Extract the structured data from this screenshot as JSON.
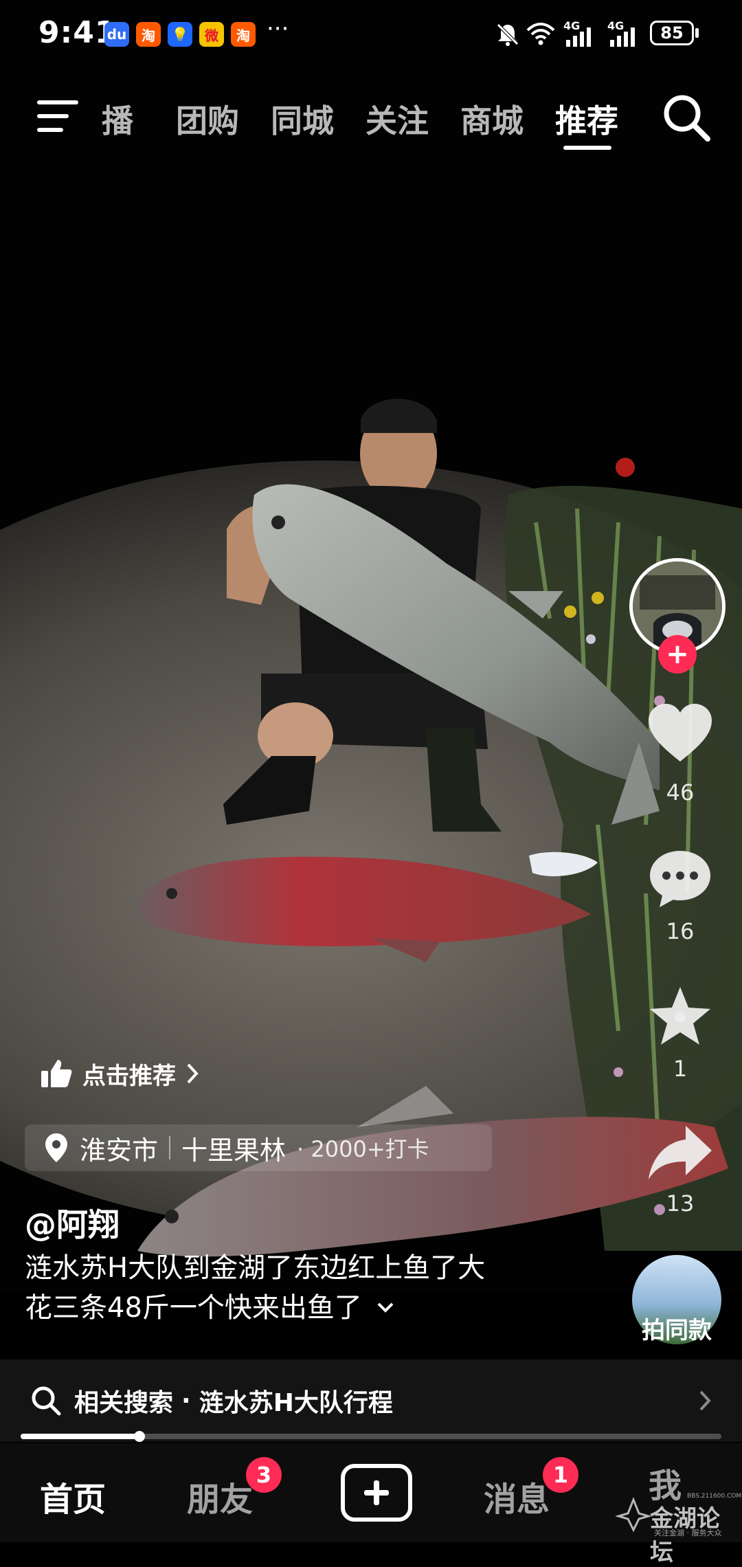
{
  "status_bar": {
    "time": "9:41",
    "app_icons": [
      {
        "icon": "baidu-icon",
        "glyph": "du",
        "color": "#2f6df6"
      },
      {
        "icon": "taobao-icon",
        "glyph": "淘",
        "color": "#ff5a00"
      },
      {
        "icon": "lightbulb-app-icon",
        "glyph": "💡",
        "color": "#1e66ff"
      },
      {
        "icon": "weibo-icon",
        "glyph": "微",
        "color": "#e6162d"
      },
      {
        "icon": "taobao-icon",
        "glyph": "淘",
        "color": "#ff5a00"
      }
    ],
    "more": "···",
    "network_1": "4G",
    "network_2": "4G",
    "battery": "85"
  },
  "top_nav": {
    "tabs": [
      {
        "label": "播",
        "active": false
      },
      {
        "label": "团购",
        "active": false
      },
      {
        "label": "同城",
        "active": false
      },
      {
        "label": "关注",
        "active": false
      },
      {
        "label": "商城",
        "active": false
      },
      {
        "label": "推荐",
        "active": true
      }
    ]
  },
  "rail": {
    "likes": "46",
    "comments": "16",
    "favorites": "1",
    "shares": "13",
    "same_style": "拍同款"
  },
  "video_info": {
    "recommend_label": "点击推荐",
    "location_city": "淮安市",
    "location_place": "十里果林",
    "location_checkins": "· 2000+打卡",
    "author": "@阿翔",
    "caption_line1": "涟水苏H大队到金湖了东边红上鱼了大",
    "caption_line2": "花三条48斤一个快来出鱼了"
  },
  "related_search": {
    "prefix": "相关搜索",
    "separator": "·",
    "query": "涟水苏H大队行程"
  },
  "progress": 0.17,
  "bottom_nav": {
    "home": "首页",
    "friends": "朋友",
    "friends_badge": "3",
    "messages": "消息",
    "messages_badge": "1",
    "me": "我"
  },
  "watermark": {
    "text": "金湖论坛",
    "sub": "关注金湖 · 服务大众",
    "url": "BBS.211600.COM"
  },
  "colors": {
    "accent": "#fe2c55",
    "background": "#000000"
  }
}
